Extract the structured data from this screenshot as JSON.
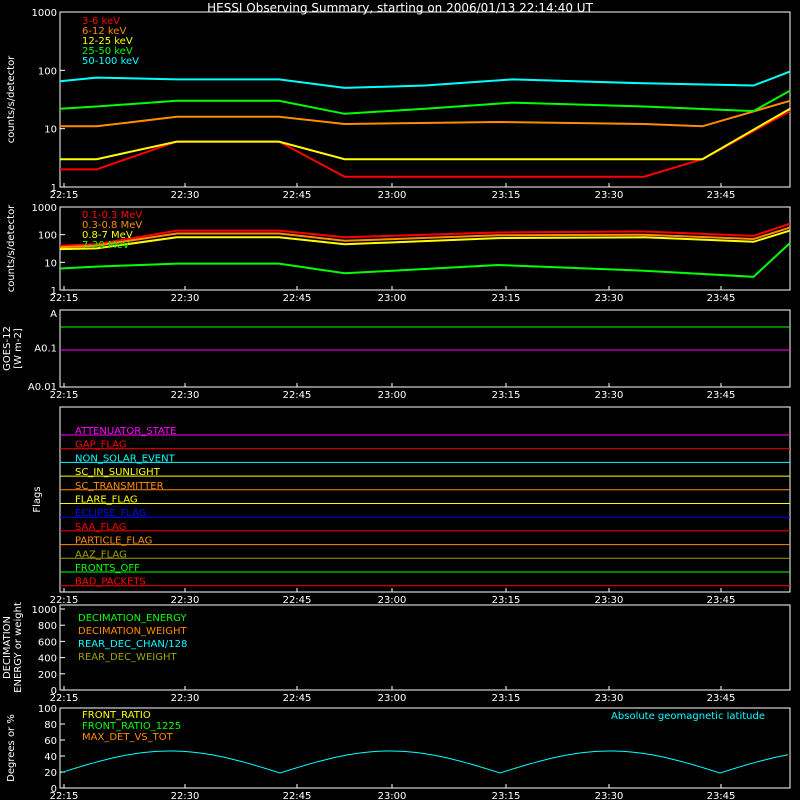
{
  "title": "HESSI Observing Summary, starting on 2006/01/13 22:14:40 UT",
  "time_ticks": [
    "22:15",
    "22:30",
    "22:45",
    "23:00",
    "23:15",
    "23:30",
    "23:45"
  ],
  "colors": {
    "red": "#ff0000",
    "orange": "#ff8c00",
    "yellow": "#ffff00",
    "green": "#00ff00",
    "cyan": "#00ffff",
    "magenta": "#ff00ff",
    "blue": "#0000ff",
    "olive": "#a0a000",
    "text": "#ffffff"
  },
  "chart_data": [
    {
      "type": "line",
      "panel": "low-energy count rates",
      "ylabel": "counts/s/detector",
      "yscale": "log",
      "ylim": [
        1,
        1000
      ],
      "y_ticks": [
        "1000",
        "100",
        "10",
        "1"
      ],
      "x_unit": "minutes after 22:14:40 UT",
      "x_range": [
        0,
        100
      ],
      "gaps_no_data": [
        [
          5.5,
          15.5
        ],
        [
          30.5,
          38.5
        ],
        [
          100,
          100
        ]
      ],
      "series": [
        {
          "name": "3-6 keV",
          "color": "#ff0000",
          "x": [
            0,
            5,
            16,
            30,
            39,
            60,
            80,
            88,
            100
          ],
          "values": [
            2,
            2,
            6,
            6,
            1.5,
            1.5,
            1.5,
            3,
            20
          ]
        },
        {
          "name": "6-12 keV",
          "color": "#ff8c00",
          "x": [
            0,
            5,
            16,
            30,
            39,
            60,
            80,
            88,
            100
          ],
          "values": [
            11,
            11,
            16,
            16,
            12,
            13,
            12,
            11,
            30
          ]
        },
        {
          "name": "12-25 keV",
          "color": "#ffff00",
          "x": [
            0,
            5,
            16,
            30,
            39,
            60,
            80,
            88,
            100
          ],
          "values": [
            3,
            3,
            6,
            6,
            3,
            3,
            3,
            3,
            22
          ]
        },
        {
          "name": "25-50 keV",
          "color": "#00ff00",
          "x": [
            0,
            5,
            16,
            30,
            39,
            50,
            62,
            80,
            95,
            100
          ],
          "values": [
            22,
            24,
            30,
            30,
            18,
            22,
            28,
            24,
            20,
            45
          ]
        },
        {
          "name": "50-100 keV",
          "color": "#00ffff",
          "x": [
            0,
            5,
            16,
            30,
            39,
            50,
            62,
            80,
            95,
            100
          ],
          "values": [
            65,
            75,
            70,
            70,
            50,
            55,
            70,
            60,
            55,
            95
          ]
        }
      ]
    },
    {
      "type": "line",
      "panel": "high-energy count rates",
      "ylabel": "counts/s/detector",
      "yscale": "log",
      "ylim": [
        1,
        1000
      ],
      "y_ticks": [
        "1000",
        "100",
        "10",
        "1"
      ],
      "x_range": [
        0,
        100
      ],
      "series": [
        {
          "name": "0.1-0.3 MeV",
          "color": "#ff0000",
          "x": [
            0,
            5,
            16,
            30,
            39,
            60,
            80,
            95,
            100
          ],
          "values": [
            40,
            45,
            140,
            140,
            80,
            120,
            130,
            90,
            250
          ]
        },
        {
          "name": "0.3-0.8 MeV",
          "color": "#ff8c00",
          "x": [
            0,
            5,
            16,
            30,
            39,
            60,
            80,
            95,
            100
          ],
          "values": [
            35,
            40,
            110,
            110,
            60,
            95,
            100,
            70,
            180
          ]
        },
        {
          "name": "0.8-7 MeV",
          "color": "#ffff00",
          "x": [
            0,
            5,
            16,
            30,
            39,
            60,
            80,
            95,
            100
          ],
          "values": [
            30,
            32,
            80,
            80,
            45,
            75,
            80,
            55,
            140
          ]
        },
        {
          "name": "7-20 MeV",
          "color": "#00ff00",
          "x": [
            0,
            5,
            16,
            30,
            39,
            60,
            80,
            95,
            100
          ],
          "values": [
            6,
            7,
            9,
            9,
            4,
            8,
            5,
            3,
            50
          ]
        }
      ]
    },
    {
      "type": "line",
      "panel": "GOES-12",
      "ylabel": "GOES-12",
      "yunit": "[W m-2]",
      "y_ticks": [
        "A",
        "A0.1",
        "A0.01"
      ],
      "x_range": [
        0,
        100
      ],
      "series": [
        {
          "name": "",
          "color": "#00ff00",
          "x": [
            0,
            100
          ],
          "values": [
            0.6,
            0.6
          ]
        },
        {
          "name": "",
          "color": "#ff00ff",
          "x": [
            0,
            100
          ],
          "values": [
            0.12,
            0.12
          ]
        }
      ]
    }
  ],
  "flags": {
    "ylabel": "Flags",
    "items": [
      {
        "name": "ATTENUATOR_STATE",
        "color": "#ff00ff"
      },
      {
        "name": "GAP_FLAG",
        "color": "#ff0000"
      },
      {
        "name": "NON_SOLAR_EVENT",
        "color": "#00ffff"
      },
      {
        "name": "SC_IN_SUNLIGHT",
        "color": "#ffff00"
      },
      {
        "name": "SC_TRANSMITTER",
        "color": "#ff8c00"
      },
      {
        "name": "FLARE_FLAG",
        "color": "#ffff00"
      },
      {
        "name": "ECLIPSE_FLAG",
        "color": "#0000ff"
      },
      {
        "name": "SAA_FLAG",
        "color": "#ff0000"
      },
      {
        "name": "PARTICLE_FLAG",
        "color": "#ff8c00"
      },
      {
        "name": "AAZ_FLAG",
        "color": "#a0a000"
      },
      {
        "name": "FRONTS_OFF",
        "color": "#00ff00"
      },
      {
        "name": "BAD_PACKETS",
        "color": "#ff0000"
      }
    ]
  },
  "decimation": {
    "ylabel_line1": "DECIMATION",
    "ylabel_line2": "ENERGY or weight",
    "y_ticks": [
      "1000",
      "800",
      "600",
      "400",
      "200",
      "0"
    ],
    "items": [
      {
        "name": "DECIMATION_ENERGY",
        "color": "#00ff00"
      },
      {
        "name": "DECIMATION_WEIGHT",
        "color": "#ff8c00"
      },
      {
        "name": "REAR_DEC_CHAN/128",
        "color": "#00ffff"
      },
      {
        "name": "REAR_DEC_WEIGHT",
        "color": "#a0a000"
      }
    ]
  },
  "ratios": {
    "ylabel": "Degrees or %",
    "y_ticks": [
      "100",
      "80",
      "60",
      "40",
      "20",
      "0"
    ],
    "items": [
      {
        "name": "FRONT_RATIO",
        "color": "#ffff00"
      },
      {
        "name": "FRONT_RATIO_1225",
        "color": "#00ff00"
      },
      {
        "name": "MAX_DET_VS_TOT",
        "color": "#ff8c00"
      }
    ],
    "annotation": "Absolute geomagnetic latitude",
    "annotation_color": "#00ffff"
  }
}
